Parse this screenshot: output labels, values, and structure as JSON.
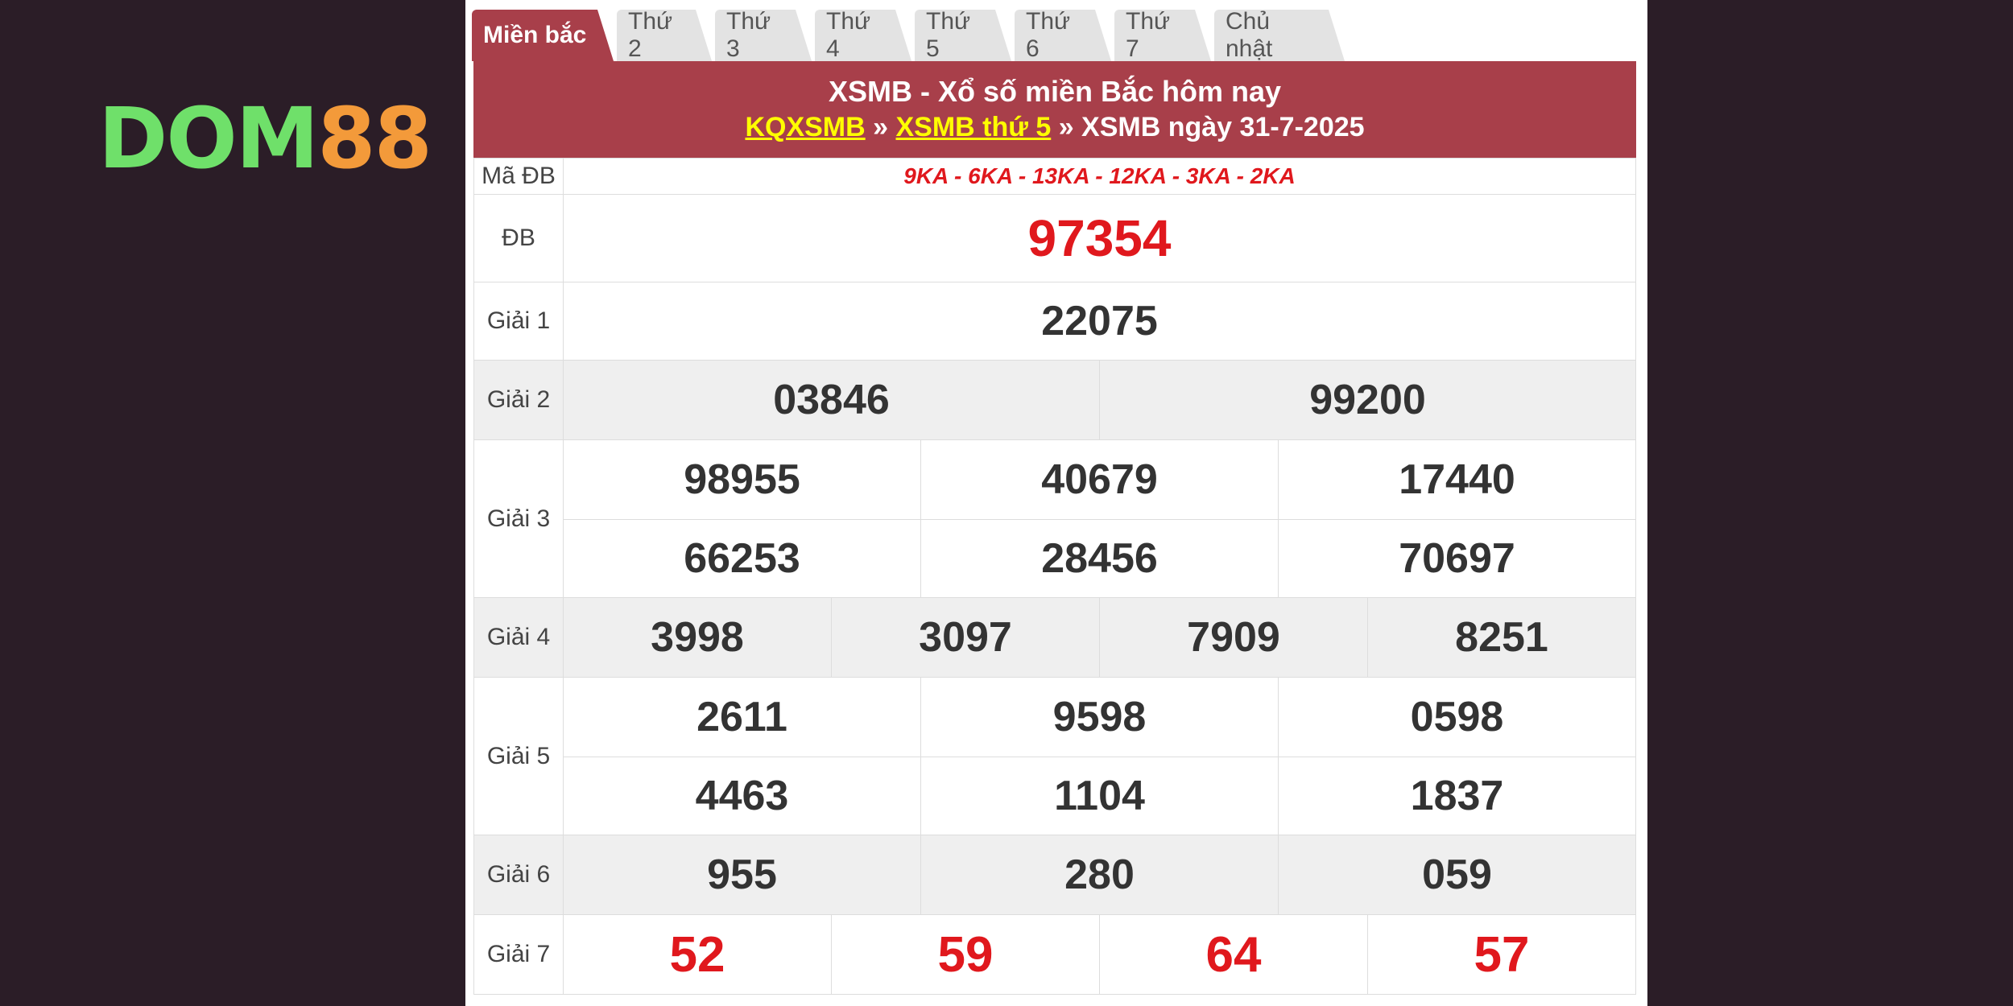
{
  "logo": {
    "part1": "DOM",
    "part2": "88"
  },
  "tabs": [
    "Miền bắc",
    "Thứ 2",
    "Thứ 3",
    "Thứ 4",
    "Thứ 5",
    "Thứ 6",
    "Thứ 7",
    "Chủ nhật"
  ],
  "header": {
    "title": "XSMB - Xổ số miền Bắc hôm nay",
    "crumb1": "KQXSMB",
    "sep": "»",
    "crumb2": "XSMB thứ 5",
    "crumb3": "» XSMB ngày 31-7-2025"
  },
  "labels": {
    "madb": "Mã ĐB",
    "db": "ĐB",
    "g1": "Giải 1",
    "g2": "Giải 2",
    "g3": "Giải 3",
    "g4": "Giải 4",
    "g5": "Giải 5",
    "g6": "Giải 6",
    "g7": "Giải 7"
  },
  "results": {
    "madb": "9KA - 6KA - 13KA - 12KA - 3KA - 2KA",
    "db": "97354",
    "g1": "22075",
    "g2": [
      "03846",
      "99200"
    ],
    "g3": [
      "98955",
      "40679",
      "17440",
      "66253",
      "28456",
      "70697"
    ],
    "g4": [
      "3998",
      "3097",
      "7909",
      "8251"
    ],
    "g5": [
      "2611",
      "9598",
      "0598",
      "4463",
      "1104",
      "1837"
    ],
    "g6": [
      "955",
      "280",
      "059"
    ],
    "g7": [
      "52",
      "59",
      "64",
      "57"
    ]
  }
}
